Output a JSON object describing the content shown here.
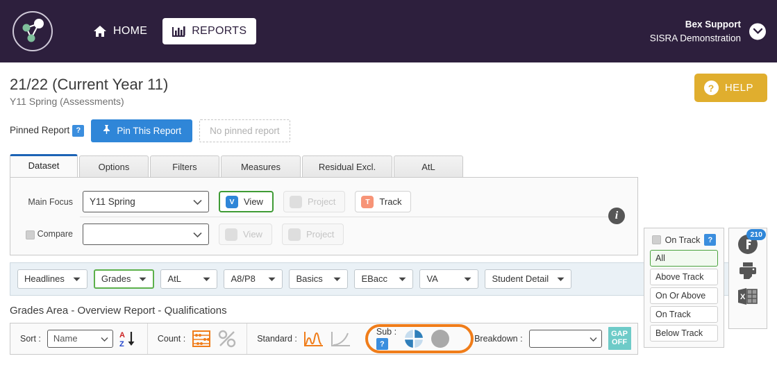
{
  "topnav": {
    "logo_name": "sisra-logo",
    "home_label": "HOME",
    "reports_label": "REPORTS",
    "user_name": "Bex Support",
    "user_org": "SISRA Demonstration",
    "bg_color": "#2d1f3d"
  },
  "header": {
    "title": "21/22 (Current Year 11)",
    "subtitle": "Y11 Spring (Assessments)",
    "help_label": "HELP",
    "help_color": "#e0ae2e"
  },
  "pinned": {
    "label": "Pinned Report",
    "help_badge": "?",
    "pin_button": "Pin This Report",
    "no_pin_text": "No pinned report",
    "pin_color": "#2f86d8"
  },
  "tabs": [
    {
      "label": "Dataset",
      "active": true
    },
    {
      "label": "Options",
      "active": false
    },
    {
      "label": "Filters",
      "active": false
    },
    {
      "label": "Measures",
      "active": false
    },
    {
      "label": "Residual Excl.",
      "active": false
    },
    {
      "label": "AtL",
      "active": false
    }
  ],
  "dataset_panel": {
    "main_focus_label": "Main Focus",
    "main_focus_value": "Y11 Spring",
    "main_focus_placeholder": "Y11 Spring",
    "view_label": "View",
    "view_badge": "V",
    "project_label": "Project",
    "track_label": "Track",
    "track_badge": "T",
    "compare_label": "Compare",
    "compare_value": "",
    "compare_placeholder": "",
    "compare_view_label": "View",
    "compare_project_label": "Project",
    "info_glyph": "i"
  },
  "track_panel": {
    "header_label": "On Track",
    "header_badge": "?",
    "options": [
      {
        "label": "All",
        "active": true
      },
      {
        "label": "Above Track",
        "active": false
      },
      {
        "label": "On Or Above",
        "active": false
      },
      {
        "label": "On Track",
        "active": false
      },
      {
        "label": "Below Track",
        "active": false
      }
    ]
  },
  "icon_column": {
    "filter_badge": "210",
    "filter_icon": "filter-funnel-icon",
    "print_icon": "printer-icon",
    "excel_icon": "excel-export-icon"
  },
  "dropdown_bar": [
    {
      "label": "Headlines",
      "selected": false
    },
    {
      "label": "Grades",
      "selected": true
    },
    {
      "label": "AtL",
      "selected": false
    },
    {
      "label": "A8/P8",
      "selected": false
    },
    {
      "label": "Basics",
      "selected": false
    },
    {
      "label": "EBacc",
      "selected": false
    },
    {
      "label": "VA",
      "selected": false
    },
    {
      "label": "Student Detail",
      "selected": false
    }
  ],
  "section": {
    "title": "Grades Area - Overview Report - Qualifications"
  },
  "toolbar": {
    "sort_label": "Sort :",
    "sort_value": "Name",
    "sort_placeholder": "Name",
    "sort_dir_icon": "sort-az-descending-icon",
    "count_label": "Count :",
    "count_icon": "abacus-icon",
    "percent_icon": "percent-icon",
    "standard_label": "Standard :",
    "distribution_icon": "distribution-curve-icon",
    "cumulative_icon": "cumulative-curve-icon",
    "sub_label": "Sub :",
    "sub_badge": "?",
    "sub_pie_icon": "pie-quadrant-icon",
    "sub_circle_icon": "solid-circle-icon",
    "breakdown_label": "Breakdown :",
    "breakdown_value": "",
    "breakdown_placeholder": "",
    "gap_line1": "GAP",
    "gap_line2": "OFF",
    "gap_color": "#6ecbc8",
    "highlight_color": "#f07d1a"
  }
}
